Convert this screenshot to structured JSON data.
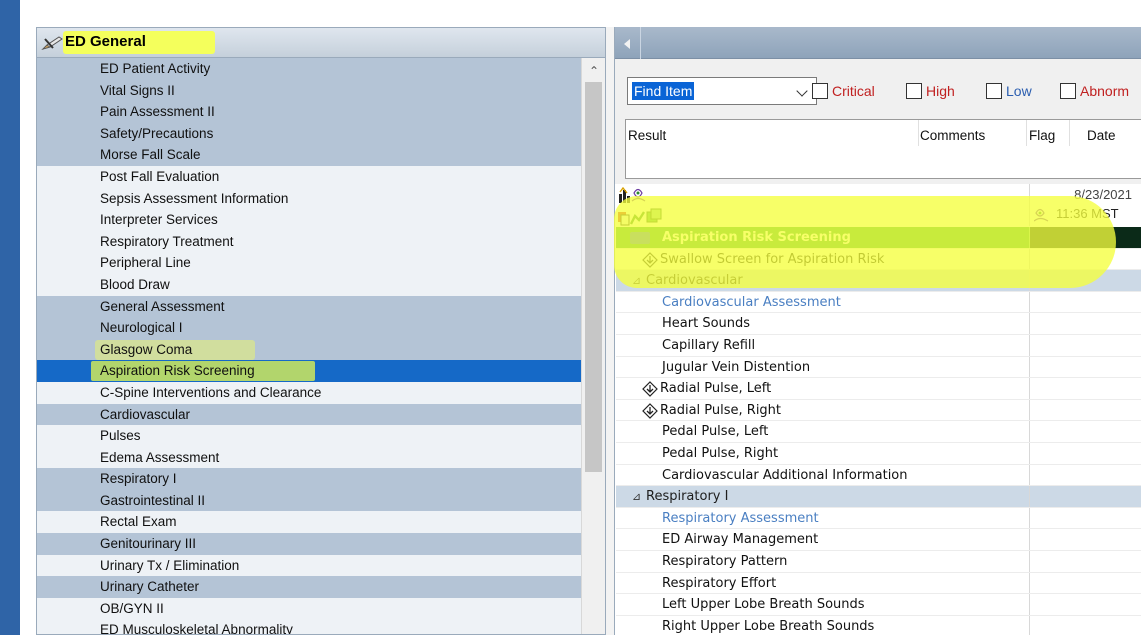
{
  "band_panel": {
    "title": "ED General",
    "selected": "Aspiration Risk Screening",
    "items": [
      {
        "label": "ED Patient Activity",
        "shade": "d"
      },
      {
        "label": "Vital Signs II",
        "shade": "d"
      },
      {
        "label": "Pain Assessment II",
        "shade": "d"
      },
      {
        "label": "Safety/Precautions",
        "shade": "d"
      },
      {
        "label": "Morse Fall Scale",
        "shade": "d"
      },
      {
        "label": "Post Fall Evaluation",
        "shade": "l"
      },
      {
        "label": "Sepsis Assessment Information",
        "shade": "l"
      },
      {
        "label": "Interpreter Services",
        "shade": "l"
      },
      {
        "label": "Respiratory Treatment",
        "shade": "l"
      },
      {
        "label": "Peripheral Line",
        "shade": "l"
      },
      {
        "label": "Blood Draw",
        "shade": "l"
      },
      {
        "label": "General Assessment",
        "shade": "d"
      },
      {
        "label": "Neurological I",
        "shade": "d"
      },
      {
        "label": "Glasgow Coma",
        "shade": "d"
      },
      {
        "label": "Aspiration Risk Screening",
        "shade": "sel"
      },
      {
        "label": "C-Spine Interventions and Clearance",
        "shade": "l"
      },
      {
        "label": "Cardiovascular",
        "shade": "d"
      },
      {
        "label": "Pulses",
        "shade": "l"
      },
      {
        "label": "Edema Assessment",
        "shade": "l"
      },
      {
        "label": "Respiratory I",
        "shade": "d"
      },
      {
        "label": "Gastrointestinal II",
        "shade": "d"
      },
      {
        "label": "Rectal Exam",
        "shade": "l"
      },
      {
        "label": "Genitourinary III",
        "shade": "d"
      },
      {
        "label": "Urinary Tx / Elimination",
        "shade": "l"
      },
      {
        "label": "Urinary Catheter",
        "shade": "d"
      },
      {
        "label": "OB/GYN II",
        "shade": "l"
      },
      {
        "label": "ED Musculoskeletal Abnormality",
        "shade": "l"
      }
    ]
  },
  "filter": {
    "find_item": "Find Item",
    "critical": "Critical",
    "high": "High",
    "low": "Low",
    "abnormal": "Abnorm",
    "colors": {
      "critical": "#c02020",
      "high": "#c02020",
      "low": "#2b5eb0",
      "abnormal": "#c02020"
    }
  },
  "result_table": {
    "col_result": "Result",
    "col_comments": "Comments",
    "col_flag": "Flag",
    "col_date": "Date"
  },
  "flowsheet": {
    "date": "8/23/2021",
    "time": "11:36 MST",
    "rows": [
      {
        "type": "asp",
        "label": "Aspiration Risk Screening"
      },
      {
        "type": "swallow",
        "label": "Swallow Screen for Aspiration Risk",
        "icon": "diamond-arrow-icon"
      },
      {
        "type": "sec",
        "label": "Cardiovascular"
      },
      {
        "type": "sub",
        "label": "Cardiovascular Assessment"
      },
      {
        "type": "item",
        "label": "Heart Sounds"
      },
      {
        "type": "item",
        "label": "Capillary Refill"
      },
      {
        "type": "item",
        "label": "Jugular Vein Distention"
      },
      {
        "type": "item-icon",
        "label": "Radial Pulse, Left",
        "icon": "diamond-arrow-icon"
      },
      {
        "type": "item-icon",
        "label": "Radial Pulse, Right",
        "icon": "diamond-arrow-icon"
      },
      {
        "type": "item",
        "label": "Pedal Pulse, Left"
      },
      {
        "type": "item",
        "label": "Pedal Pulse, Right"
      },
      {
        "type": "item",
        "label": "Cardiovascular Additional Information"
      },
      {
        "type": "sec",
        "label": "Respiratory I"
      },
      {
        "type": "sub",
        "label": "Respiratory Assessment"
      },
      {
        "type": "item",
        "label": "ED Airway Management"
      },
      {
        "type": "item",
        "label": "Respiratory Pattern"
      },
      {
        "type": "item",
        "label": "Respiratory Effort"
      },
      {
        "type": "item",
        "label": "Left Upper Lobe Breath Sounds"
      },
      {
        "type": "item",
        "label": "Right Upper Lobe Breath Sounds"
      }
    ]
  }
}
